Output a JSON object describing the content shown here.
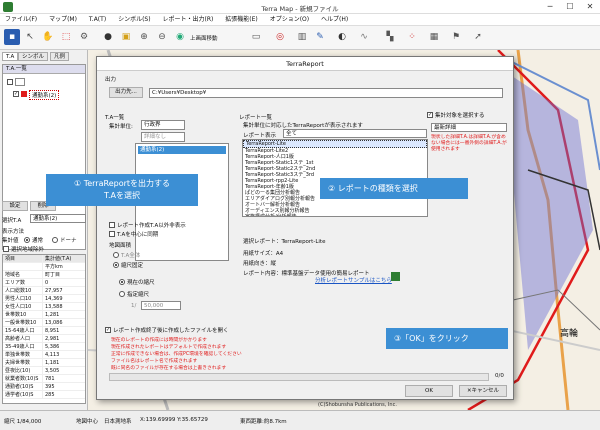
{
  "app": {
    "title": "Terra Map - 新規ファイル",
    "menu": [
      "ファイル(F)",
      "マップ(M)",
      "T.A(T)",
      "シンボル(S)",
      "レポート・出力(R)",
      "拡張機能(E)",
      "オプション(O)",
      "ヘルプ(H)"
    ],
    "toolbar_zoom_label": "上画面移動"
  },
  "left": {
    "tabs": [
      "T.A",
      "シンボル",
      "凡例"
    ],
    "group_header": "T.A.一覧",
    "ta_item": "通勤系(2)",
    "btn_settings": "設定",
    "btn_delete": "削除",
    "selected_label": "選択T.A",
    "selected_value": "通勤系(2)",
    "display_label": "表示方法",
    "aggregate_label": "集計値",
    "radio_normal": "通常",
    "radio_donut": "ドーナ",
    "checkbox_label": "選択地域除外",
    "table_headers": [
      "項目",
      "集計値(T.A)"
    ],
    "table_rows": [
      [
        "",
        "平方km"
      ],
      [
        "地域名",
        "町丁目"
      ],
      [
        "エリア数",
        "0"
      ],
      [
        "人口総数10",
        "27,957"
      ],
      [
        "男性人口10",
        "14,369"
      ],
      [
        "女性人口10",
        "13,588"
      ],
      [
        "世帯数10",
        "1,281"
      ],
      [
        "一般世帯数10",
        "13,086"
      ],
      [
        "15-64歳人口",
        "8,951"
      ],
      [
        "高齢者人口",
        "2,981"
      ],
      [
        "35-49歳人口",
        "5,386"
      ],
      [
        "単独世帯数",
        "4,113"
      ],
      [
        "夫婦世帯数",
        "1,181"
      ],
      [
        "昼夜比(10)",
        "3,505"
      ],
      [
        "就業者数(10)S",
        "781"
      ],
      [
        "通勤者(10)S",
        "395"
      ],
      [
        "通学者(10)S",
        "285"
      ]
    ]
  },
  "map": {
    "labels": [
      "高輪",
      "(C)Shobunsha Publications, Inc."
    ]
  },
  "status": {
    "scale": "縮尺 1/84,000",
    "coord_label": "地図中心",
    "datum": "日本測地系",
    "coords": "X:139.69999 Y:35.65729",
    "extent": "東西距離:約8.7km"
  },
  "dialog": {
    "title": "TerraReport",
    "output_group": "出力",
    "output_button": "出力先...",
    "output_path": "C:¥Users¥Desktop¥",
    "ta_list_label": "T.A一覧",
    "agg_unit_label": "集計単位:",
    "agg_unit_value": "行政界",
    "detail_placeholder": "詳細なし",
    "ta_list_item": "通勤系(2)",
    "report_list_label": "レポート一覧",
    "report_hint": "集計単位に対応したTerraReportが表示されます",
    "report_display_label": "レポート表示",
    "report_display_value": "全て",
    "reports": [
      "TerraReport-Lite",
      "TerraReport-Lite2",
      "TerraReport-人口1版",
      "TerraReport-Static1ステ_1st",
      "TerraReport-Static2ステ_2nd",
      "TerraReport-Static3ステ_3rd",
      "TerraReport-rpp2-Lite",
      "TerraReport-年齢1版",
      "ぱどのーる集団分析報告",
      "エリアダイアログ別報分析報告",
      "オートバー解析分析報告",
      "オーディエンス別報分析報告",
      "家族構成分析/分析報告",
      "家計収支分析/分析報告"
    ],
    "selected_report_label": "選択レポート：TerraReport-Lite",
    "paper_size_label": "用紙サイズ：A4",
    "orientation_label": "用紙向き：縦",
    "content_label": "レポート内容：標準基盤データ使用の簡易レポート",
    "sample_link": "分析レポートサンプルはこちら",
    "aggregate_check": "集計対象を選択する",
    "aggregate_select": "最新詳細",
    "aggregate_note": "現状した詳細T.A.は詳細T.A.が含めない場合には一番外側の詳細T.A.が使用されます",
    "cb_unit": "レポート作成T.A以外非表示",
    "cb_ta_only": "T.Aを中心に同期",
    "area_group": "地図面積",
    "radio_ta": "T.A全体",
    "radio_fixed": "縮尺固定",
    "radio_current": "現在の縮尺",
    "radio_specified": "指定縮尺",
    "scale_prefix": "1/",
    "scale_value": "50,000",
    "open_file_check": "レポート作成終了後に作成したファイルを開く",
    "warnings": [
      "現在のレポートの作成には時間がかかります",
      "現在作成されたレポートはデフォルトで作成されます",
      "正常に作成できない場合は、作成PC環境を確認してください",
      "ファイル名はレポート名で作成されます",
      "既に同名のファイルが存在する場合は上書きされます"
    ],
    "progress_text": "0/0",
    "ok_button": "OK",
    "cancel_button": "キャンセル"
  },
  "callouts": {
    "step1": "① TerraReportを出力する",
    "step1b": "T.Aを選択",
    "step2": "② レポートの種類を選択",
    "step3": "③「OK」をクリック"
  },
  "colors": {
    "callout": "#3c8fd4",
    "map_bg": "#f7f3ea",
    "ta_red": "#e01b1b"
  }
}
